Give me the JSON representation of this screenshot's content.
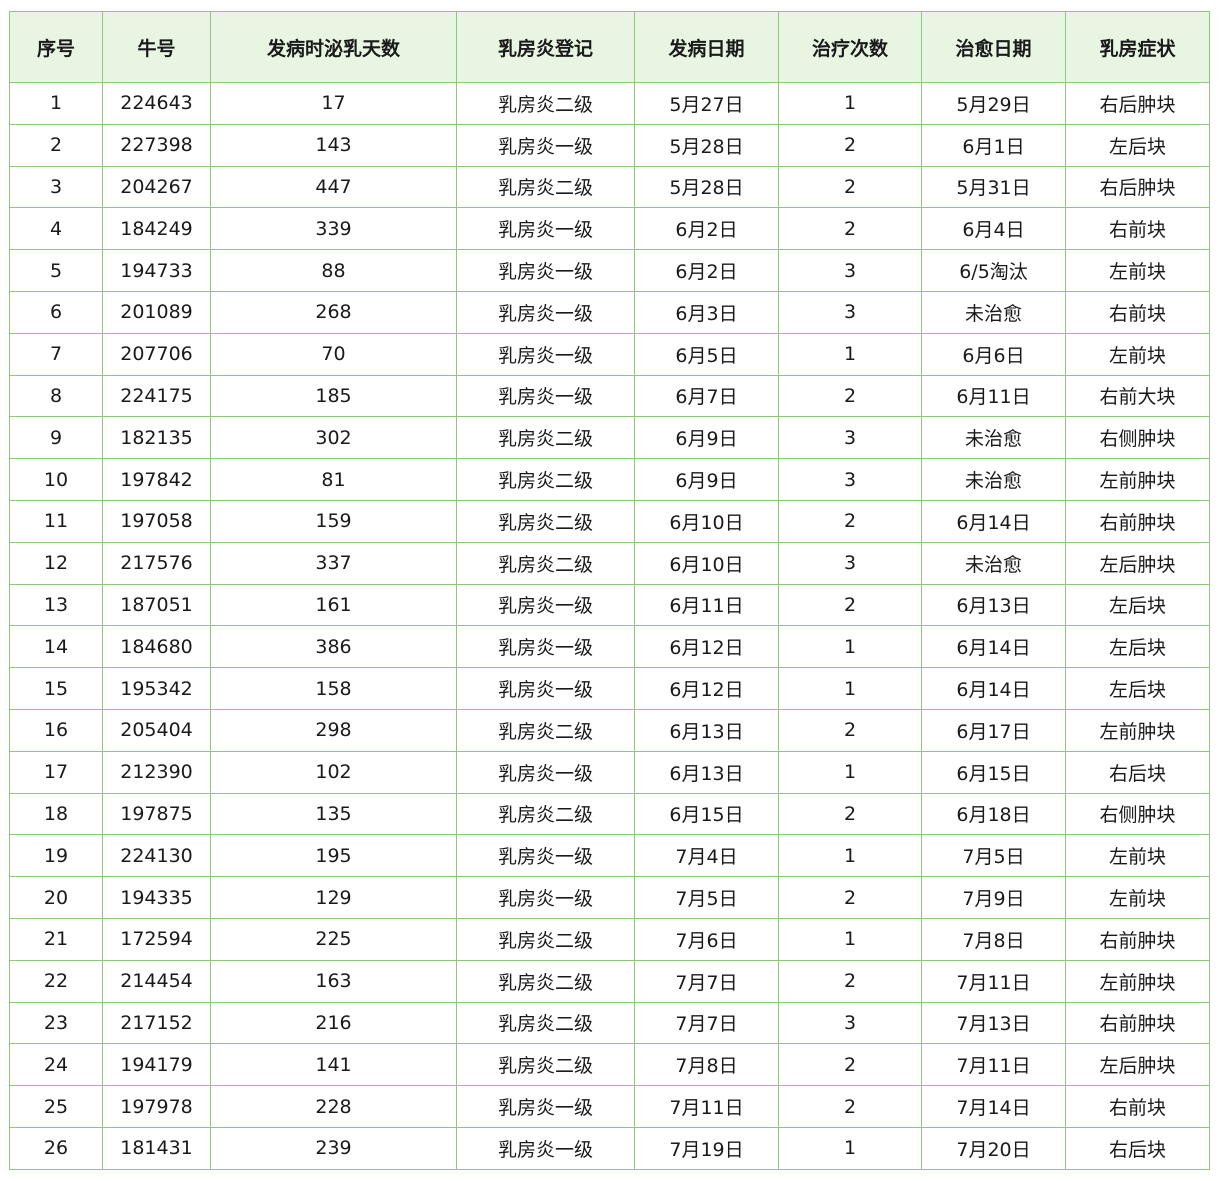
{
  "table": {
    "columns": [
      "序号",
      "牛号",
      "发病时泌乳天数",
      "乳房炎登记",
      "发病日期",
      "治疗次数",
      "治愈日期",
      "乳房症状"
    ],
    "rows": [
      [
        "1",
        "224643",
        "17",
        "乳房炎二级",
        "5月27日",
        "1",
        "5月29日",
        "右后肿块"
      ],
      [
        "2",
        "227398",
        "143",
        "乳房炎一级",
        "5月28日",
        "2",
        "6月1日",
        "左后块"
      ],
      [
        "3",
        "204267",
        "447",
        "乳房炎二级",
        "5月28日",
        "2",
        "5月31日",
        "右后肿块"
      ],
      [
        "4",
        "184249",
        "339",
        "乳房炎一级",
        "6月2日",
        "2",
        "6月4日",
        "右前块"
      ],
      [
        "5",
        "194733",
        "88",
        "乳房炎一级",
        "6月2日",
        "3",
        "6/5淘汰",
        "左前块"
      ],
      [
        "6",
        "201089",
        "268",
        "乳房炎一级",
        "6月3日",
        "3",
        "未治愈",
        "右前块"
      ],
      [
        "7",
        "207706",
        "70",
        "乳房炎一级",
        "6月5日",
        "1",
        "6月6日",
        "左前块"
      ],
      [
        "8",
        "224175",
        "185",
        "乳房炎一级",
        "6月7日",
        "2",
        "6月11日",
        "右前大块"
      ],
      [
        "9",
        "182135",
        "302",
        "乳房炎二级",
        "6月9日",
        "3",
        "未治愈",
        "右侧肿块"
      ],
      [
        "10",
        "197842",
        "81",
        "乳房炎二级",
        "6月9日",
        "3",
        "未治愈",
        "左前肿块"
      ],
      [
        "11",
        "197058",
        "159",
        "乳房炎二级",
        "6月10日",
        "2",
        "6月14日",
        "右前肿块"
      ],
      [
        "12",
        "217576",
        "337",
        "乳房炎二级",
        "6月10日",
        "3",
        "未治愈",
        "左后肿块"
      ],
      [
        "13",
        "187051",
        "161",
        "乳房炎一级",
        "6月11日",
        "2",
        "6月13日",
        "左后块"
      ],
      [
        "14",
        "184680",
        "386",
        "乳房炎一级",
        "6月12日",
        "1",
        "6月14日",
        "左后块"
      ],
      [
        "15",
        "195342",
        "158",
        "乳房炎一级",
        "6月12日",
        "1",
        "6月14日",
        "左后块"
      ],
      [
        "16",
        "205404",
        "298",
        "乳房炎二级",
        "6月13日",
        "2",
        "6月17日",
        "左前肿块"
      ],
      [
        "17",
        "212390",
        "102",
        "乳房炎一级",
        "6月13日",
        "1",
        "6月15日",
        "右后块"
      ],
      [
        "18",
        "197875",
        "135",
        "乳房炎二级",
        "6月15日",
        "2",
        "6月18日",
        "右侧肿块"
      ],
      [
        "19",
        "224130",
        "195",
        "乳房炎一级",
        "7月4日",
        "1",
        "7月5日",
        "左前块"
      ],
      [
        "20",
        "194335",
        "129",
        "乳房炎一级",
        "7月5日",
        "2",
        "7月9日",
        "左前块"
      ],
      [
        "21",
        "172594",
        "225",
        "乳房炎二级",
        "7月6日",
        "1",
        "7月8日",
        "右前肿块"
      ],
      [
        "22",
        "214454",
        "163",
        "乳房炎二级",
        "7月7日",
        "2",
        "7月11日",
        "左前肿块"
      ],
      [
        "23",
        "217152",
        "216",
        "乳房炎二级",
        "7月7日",
        "3",
        "7月13日",
        "右前肿块"
      ],
      [
        "24",
        "194179",
        "141",
        "乳房炎二级",
        "7月8日",
        "2",
        "7月11日",
        "左后肿块"
      ],
      [
        "25",
        "197978",
        "228",
        "乳房炎一级",
        "7月11日",
        "2",
        "7月14日",
        "右前块"
      ],
      [
        "26",
        "181431",
        "239",
        "乳房炎一级",
        "7月19日",
        "1",
        "7月20日",
        "右后块"
      ]
    ]
  },
  "colors": {
    "header_bg": "#e7f5e2",
    "border": "#8cc97a",
    "text": "#1a1a1a"
  }
}
